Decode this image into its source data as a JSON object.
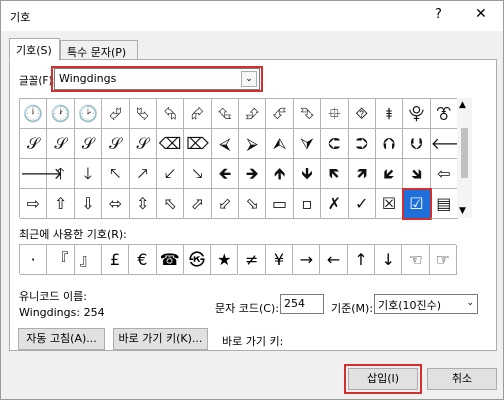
{
  "window": {
    "title": "기호",
    "help": "?",
    "close": "✕"
  },
  "tabs": [
    {
      "label": "기호(S)"
    },
    {
      "label": "특수 문자(P)"
    }
  ],
  "font": {
    "label": "글꼴(F):",
    "value": "Wingdings",
    "dropdown": "⌄"
  },
  "symbols": [
    [
      "🕛",
      "🕐",
      "🕑",
      "⮰",
      "⮱",
      "⮲",
      "⮳",
      "⮴",
      "⮵",
      "⮶",
      "⮷",
      "⯐",
      "⯑",
      "⯒",
      "⯓",
      "⯔"
    ],
    [
      "𝒮",
      "𝒮",
      "𝒮",
      "𝒮",
      "𝒮",
      "⌫",
      "⌦",
      "⮘",
      "⮚",
      "⮙",
      "⮛",
      "⮈",
      "⮊",
      "⮉",
      "⮋",
      "🡐"
    ],
    [
      "🡒",
      "🡑",
      "🡓",
      "🡔",
      "🡕",
      "🡗",
      "🡖",
      "🡸",
      "🡺",
      "🡹",
      "🡻",
      "🡼",
      "🡽",
      "🡿",
      "🡾",
      "⇦"
    ],
    [
      "⇨",
      "⇧",
      "⇩",
      "⬄",
      "⇳",
      "⬁",
      "⬀",
      "⬃",
      "⬂",
      "▭",
      "▫",
      "✗",
      "✓",
      "☒",
      "☑",
      "▤"
    ]
  ],
  "selected_index": 62,
  "scrollbar": {
    "up": "▲",
    "down": "▼"
  },
  "recent": {
    "label": "최근에 사용한 기호(R):",
    "items": [
      "·",
      "『",
      "』",
      "£",
      "€",
      "☎",
      "㉿",
      "★",
      "≠",
      "¥",
      "→",
      "←",
      "↑",
      "↓",
      "☜",
      "☞"
    ]
  },
  "unicode": {
    "label": "유니코드 이름:",
    "value": "Wingdings: 254"
  },
  "char_code": {
    "label": "문자 코드(C):",
    "value": "254"
  },
  "base": {
    "label": "기준(M):",
    "value": "기호(10진수)",
    "dropdown": "⌄"
  },
  "buttons": {
    "autocorrect": "자동 고침(A)...",
    "shortcut_key": "바로 가기 키(K)...",
    "shortcut_label": "바로 가기 키:",
    "insert": "삽입(I)",
    "cancel": "취소"
  }
}
